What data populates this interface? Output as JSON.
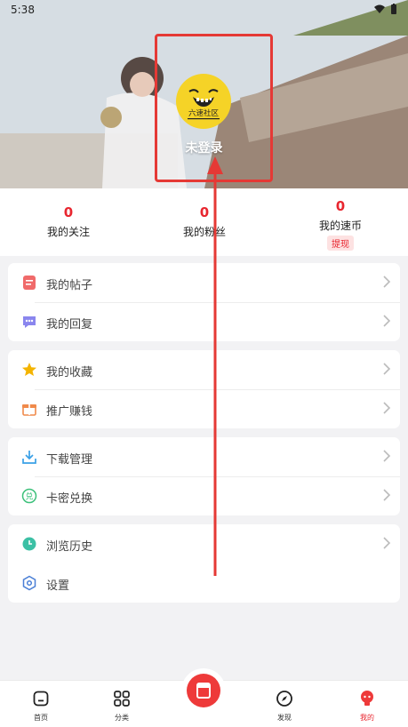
{
  "status_bar": {
    "time": "5:38"
  },
  "profile": {
    "avatar_text": "六速社区",
    "login_prompt": "未登录"
  },
  "stats": [
    {
      "value": "0",
      "label": "我的关注"
    },
    {
      "value": "0",
      "label": "我的粉丝"
    },
    {
      "value": "0",
      "label": "我的速币",
      "badge": "提现"
    }
  ],
  "menu": {
    "group1": [
      "我的帖子",
      "我的回复"
    ],
    "group2": [
      "我的收藏",
      "推广赚钱"
    ],
    "group3": [
      "下载管理",
      "卡密兑换"
    ],
    "group4": [
      "浏览历史",
      "设置"
    ]
  },
  "bottom_nav": [
    {
      "label": "首页",
      "icon": "home-icon"
    },
    {
      "label": "分类",
      "icon": "category-icon"
    },
    {
      "label": "",
      "icon": "center-action-icon"
    },
    {
      "label": "发现",
      "icon": "compass-icon"
    },
    {
      "label": "我的",
      "icon": "profile-icon",
      "active": true
    }
  ],
  "colors": {
    "accent": "#e8262f",
    "highlight": "#e53935"
  }
}
